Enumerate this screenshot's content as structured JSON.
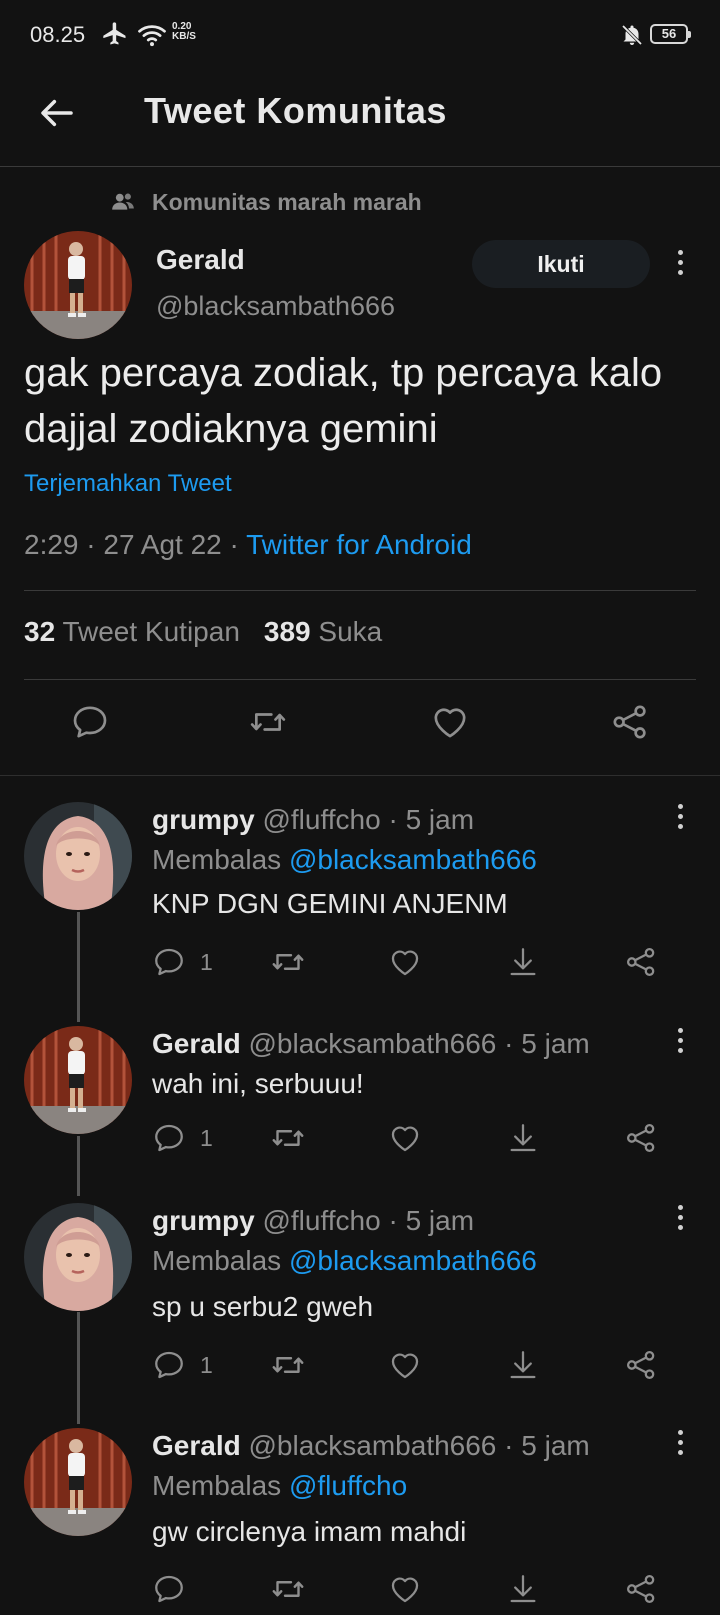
{
  "status_bar": {
    "time": "08.25",
    "speed_value": "0.20",
    "speed_unit": "KB/S",
    "battery": "56"
  },
  "header": {
    "title": "Tweet Komunitas"
  },
  "main_tweet": {
    "community": "Komunitas marah marah",
    "name": "Gerald",
    "handle": "@blacksambath666",
    "follow_label": "Ikuti",
    "text": "gak percaya zodiak, tp percaya kalo dajjal zodiaknya gemini",
    "translate": "Terjemahkan Tweet",
    "time": "2:29",
    "date": "27 Agt 22",
    "source": "Twitter for Android",
    "quote_count": "32",
    "quote_label": "Tweet Kutipan",
    "like_count": "389",
    "like_label": "Suka"
  },
  "replies": [
    {
      "name": "grumpy",
      "handle": "@fluffcho",
      "age": "5 jam",
      "reply_prefix": "Membalas",
      "reply_to": "@blacksambath666",
      "text": "KNP DGN GEMINI ANJENM",
      "reply_count": "1"
    },
    {
      "name": "Gerald",
      "handle": "@blacksambath666",
      "age": "5 jam",
      "reply_prefix": "",
      "reply_to": "",
      "text": "wah ini, serbuuu!",
      "reply_count": "1"
    },
    {
      "name": "grumpy",
      "handle": "@fluffcho",
      "age": "5 jam",
      "reply_prefix": "Membalas",
      "reply_to": "@blacksambath666",
      "text": "sp u serbu2 gweh",
      "reply_count": "1"
    },
    {
      "name": "Gerald",
      "handle": "@blacksambath666",
      "age": "5 jam",
      "reply_prefix": "Membalas",
      "reply_to": "@fluffcho",
      "text": "gw circlenya imam mahdi",
      "reply_count": ""
    }
  ],
  "colors": {
    "background": "#121212",
    "accent": "#1d9bf0",
    "muted": "#8e8e8e"
  }
}
